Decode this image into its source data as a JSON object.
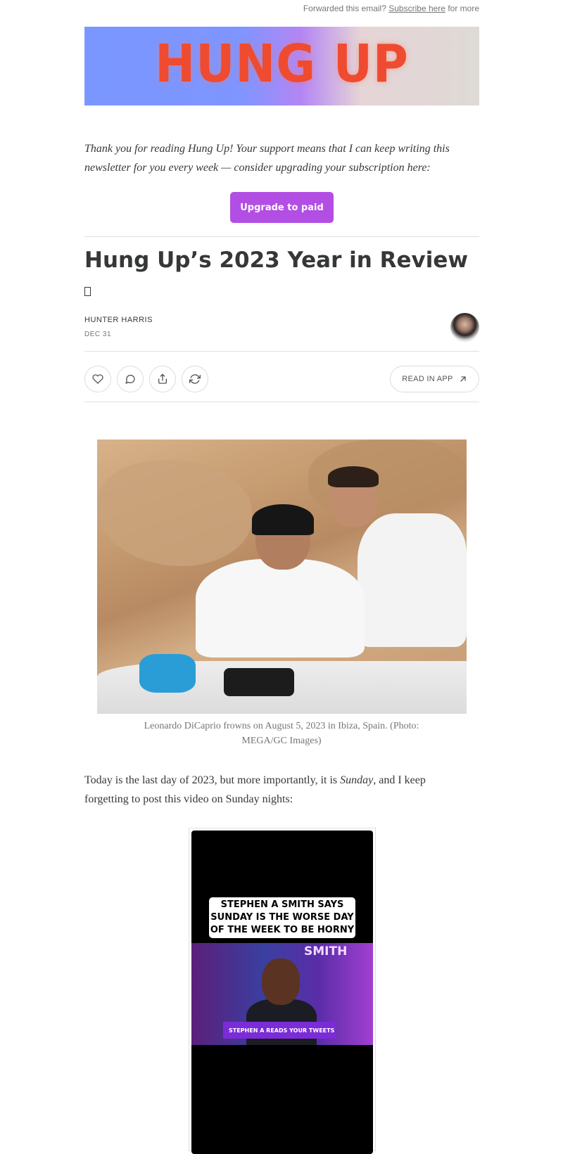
{
  "header": {
    "forward_prefix": "Forwarded this email?",
    "subscribe_link": "Subscribe here",
    "forward_suffix": "for more"
  },
  "banner": {
    "logo_text": "HUNG UP"
  },
  "intro": {
    "text": "Thank you for reading Hung Up! Your support means that I can keep writing this newsletter for you every week — consider upgrading your subscription here:"
  },
  "cta": {
    "upgrade_label": "Upgrade to paid"
  },
  "post": {
    "title": "Hung Up’s 2023 Year in Review",
    "author": "HUNTER HARRIS",
    "date": "DEC 31"
  },
  "actions": {
    "read_in_app": "READ IN APP",
    "icons": [
      "heart-icon",
      "comment-icon",
      "share-icon",
      "restack-icon",
      "arrow-up-right-icon"
    ]
  },
  "photo": {
    "caption": "Leonardo DiCaprio frowns on August 5, 2023 in Ibiza, Spain. (Photo: MEGA/GC Images)"
  },
  "body": {
    "paragraph_before": "Today is the last day of 2023, but more importantly, it is ",
    "paragraph_emphasis": "Sunday",
    "paragraph_after": ", and I keep forgetting to post this video on Sunday nights:"
  },
  "video": {
    "caption": "STEPHEN A SMITH SAYS SUNDAY IS THE WORSE DAY OF THE WEEK TO BE HORNY",
    "show_logo": "SMITH",
    "lower_third": "STEPHEN A READS YOUR TWEETS"
  },
  "colors": {
    "accent": "#b24ee4",
    "logo": "#ef4b30",
    "text": "#363737",
    "muted": "#757575"
  }
}
